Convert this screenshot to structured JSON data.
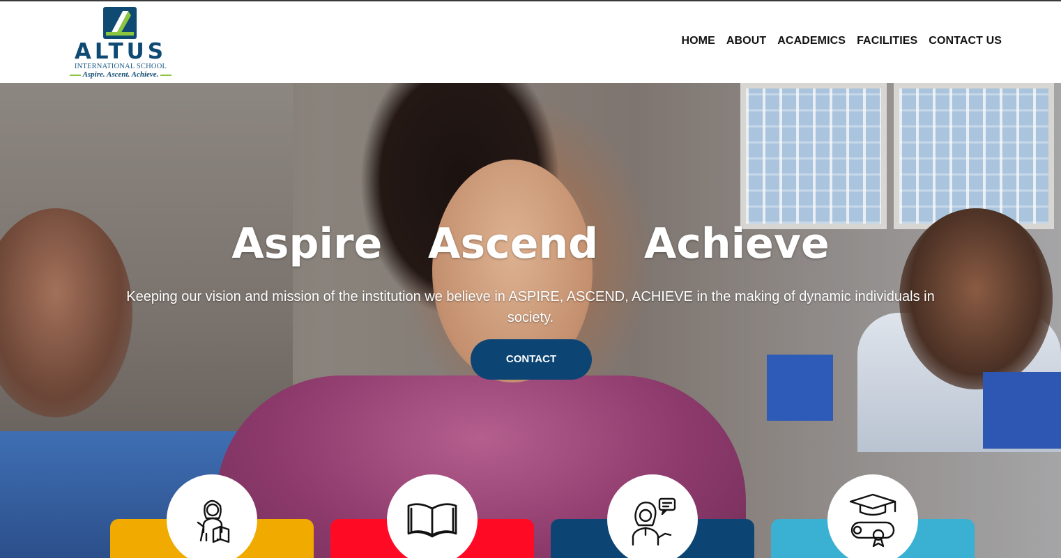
{
  "brand": {
    "name": "ALTUS",
    "subtitle": "INTERNATIONAL SCHOOL",
    "tagline": "Aspire. Ascent. Achieve.",
    "colors": {
      "primary": "#0c4574",
      "accent_green": "#8cc63f"
    }
  },
  "nav": {
    "items": [
      {
        "label": "HOME"
      },
      {
        "label": "ABOUT"
      },
      {
        "label": "ACADEMICS"
      },
      {
        "label": "FACILITIES"
      },
      {
        "label": "CONTACT US"
      }
    ]
  },
  "hero": {
    "title": "Aspire  Ascend  Achieve",
    "text": "Keeping our vision and mission of the institution we believe in ASPIRE, ASCEND, ACHIEVE in the making of dynamic individuals in society.",
    "button_label": "CONTACT"
  },
  "features": [
    {
      "icon": "reading-teacher-icon",
      "color": "#f0aa00"
    },
    {
      "icon": "open-book-icon",
      "color": "#ff0a25"
    },
    {
      "icon": "speaking-person-icon",
      "color": "#0c4574"
    },
    {
      "icon": "graduation-cap-diploma-icon",
      "color": "#3ab0d3"
    }
  ]
}
